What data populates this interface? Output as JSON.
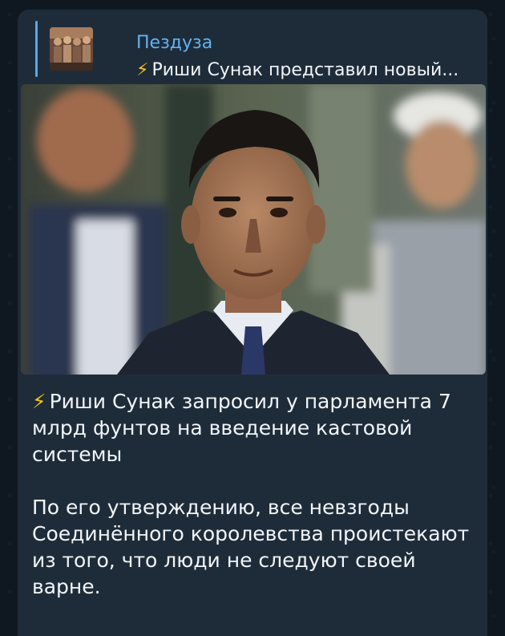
{
  "reply": {
    "author": "Пездуза",
    "preview_icon": "lightning-emoji",
    "preview_text": "Риши Сунак представил новый..."
  },
  "message": {
    "icon": "lightning-emoji",
    "paragraph1": "Риши Сунак запросил у парламента 7 млрд фунтов на введение кастовой системы",
    "paragraph2": "По его утверждению, все невзгоды Соединённого королевства проистекают из того, что люди не следуют своей варне."
  },
  "colors": {
    "accent": "#62b3ef",
    "bubble": "#1e2c3a",
    "background": "#0f1820",
    "lightning": "#f5c518"
  }
}
